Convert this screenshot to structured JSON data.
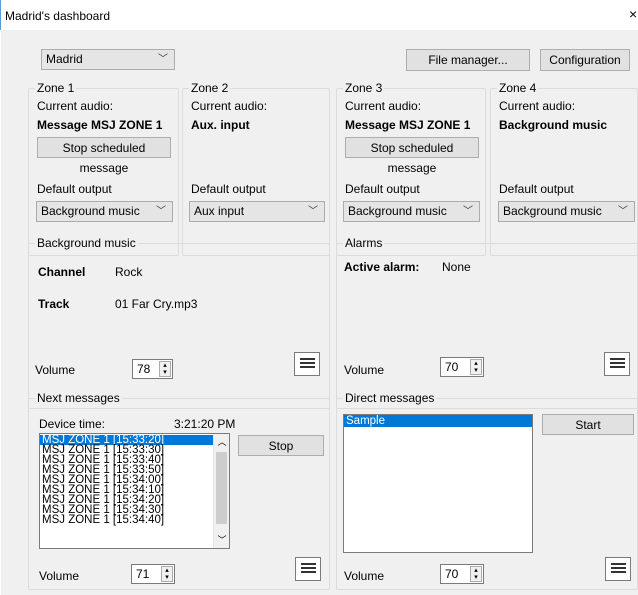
{
  "window": {
    "title": "Madrid's dashboard",
    "close_glyph": "×"
  },
  "top": {
    "city_select": "Madrid",
    "file_manager": "File manager...",
    "configuration": "Configuration"
  },
  "zones": [
    {
      "legend": "Zone 1",
      "current_audio_label": "Current audio:",
      "current_audio": "Message MSJ ZONE 1",
      "stop_button": "Stop scheduled message",
      "default_output_label": "Default output",
      "default_output": "Background music"
    },
    {
      "legend": "Zone 2",
      "current_audio_label": "Current audio:",
      "current_audio": "Aux. input",
      "default_output_label": "Default output",
      "default_output": "Aux input"
    },
    {
      "legend": "Zone 3",
      "current_audio_label": "Current audio:",
      "current_audio": "Message MSJ ZONE 1",
      "stop_button": "Stop scheduled message",
      "default_output_label": "Default output",
      "default_output": "Background music"
    },
    {
      "legend": "Zone 4",
      "current_audio_label": "Current audio:",
      "current_audio": "Background music",
      "default_output_label": "Default output",
      "default_output": "Background music"
    }
  ],
  "background_music": {
    "legend": "Background music",
    "channel_label": "Channel",
    "channel": "Rock",
    "track_label": "Track",
    "track": "01 Far Cry.mp3",
    "volume_label": "Volume",
    "volume": "78"
  },
  "alarms": {
    "legend": "Alarms",
    "active_label": "Active alarm:",
    "active": "None",
    "volume_label": "Volume",
    "volume": "70"
  },
  "next_messages": {
    "legend": "Next messages",
    "device_time_label": "Device time:",
    "device_time": "3:21:20 PM",
    "stop_button": "Stop",
    "items": [
      "MSJ ZONE 1 [15:33:20]",
      "MSJ ZONE 1 [15:33:30]",
      "MSJ ZONE 1 [15:33:40]",
      "MSJ ZONE 1 [15:33:50]",
      "MSJ ZONE 1 [15:34:00]",
      "MSJ ZONE 1 [15:34:10]",
      "MSJ ZONE 1 [15:34:20]",
      "MSJ ZONE 1 [15:34:30]",
      "MSJ ZONE 1 [15:34:40]"
    ],
    "volume_label": "Volume",
    "volume": "71"
  },
  "direct_messages": {
    "legend": "Direct messages",
    "items": [
      "Sample"
    ],
    "start_button": "Start",
    "volume_label": "Volume",
    "volume": "70"
  },
  "icons": {
    "dropdown": "chevron-down-icon",
    "list": "list-icon",
    "spin": "spin-updown-icon"
  }
}
